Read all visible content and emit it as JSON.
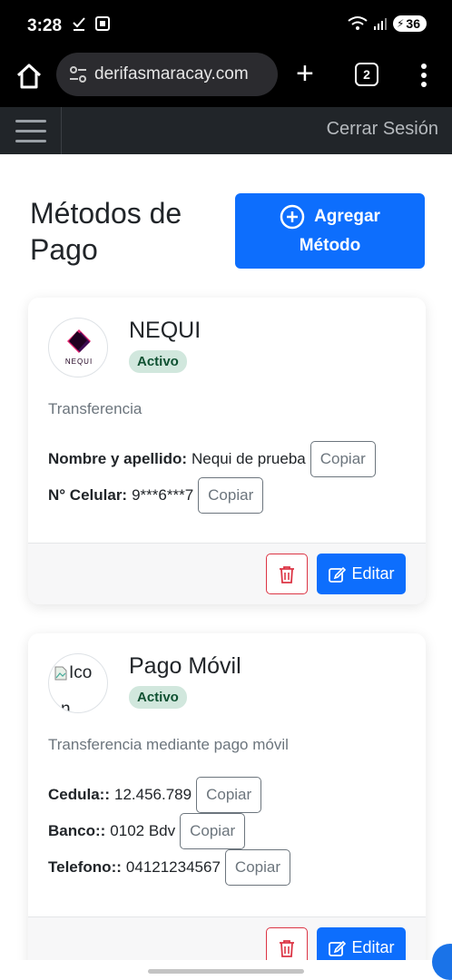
{
  "status_bar": {
    "time": "3:28",
    "battery": "36",
    "left_icons": [
      "check-download-icon",
      "screenshot-icon"
    ],
    "right_icons": [
      "wifi-icon",
      "signal-icon",
      "battery-icon"
    ]
  },
  "browser": {
    "url": "derifasmaracay.com",
    "tab_count": "2"
  },
  "navbar": {
    "logout": "Cerrar Sesión"
  },
  "page": {
    "title_line1": "Métodos de",
    "title_line2": "Pago",
    "add_button_line1": "Agregar",
    "add_button_line2": "Método"
  },
  "methods": [
    {
      "name": "NEQUI",
      "status": "Activo",
      "type": "Transferencia",
      "logo_text": "NEQUI",
      "fields": [
        {
          "label": "Nombre y apellido:",
          "value": "Nequi de prueba",
          "copy": "Copiar"
        },
        {
          "label": "N° Celular:",
          "value": "9***6***7",
          "copy": "Copiar"
        }
      ],
      "edit_label": "Editar"
    },
    {
      "name": "Pago Móvil",
      "status": "Activo",
      "type": "Transferencia mediante pago móvil",
      "logo_alt": "Ico",
      "logo_alt_cut": "n",
      "fields": [
        {
          "label": "Cedula::",
          "value": "12.456.789",
          "copy": "Copiar"
        },
        {
          "label": "Banco::",
          "value": "0102 Bdv",
          "copy": "Copiar"
        },
        {
          "label": "Telefono::",
          "value": "04121234567",
          "copy": "Copiar"
        }
      ],
      "edit_label": "Editar"
    }
  ],
  "colors": {
    "primary": "#0d6efd",
    "danger": "#dc3545",
    "navbar": "#212529",
    "badge_bg": "#d1e7dd",
    "badge_text": "#0f5132"
  }
}
